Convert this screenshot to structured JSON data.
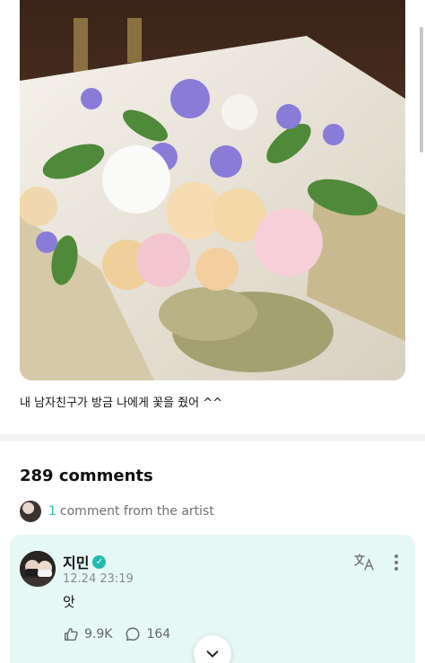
{
  "post": {
    "caption": "내 남자친구가 방금 나에게 꽃을 줬어 ^^"
  },
  "comments": {
    "count_label": "289 comments",
    "artist_count": "1",
    "artist_label": "comment from the artist"
  },
  "comment": {
    "author": "지민",
    "verified": true,
    "date": "12.24 23:19",
    "text": "앗",
    "likes": "9.9K",
    "replies": "164"
  },
  "colors": {
    "accent": "#2bbfb0",
    "card_bg": "#e6f8f5"
  },
  "icons": {
    "verified": "verified-badge-icon",
    "translate": "translate-icon",
    "more": "more-vertical-icon",
    "like": "like-icon",
    "reply": "reply-icon",
    "expand": "chevron-down-icon"
  }
}
